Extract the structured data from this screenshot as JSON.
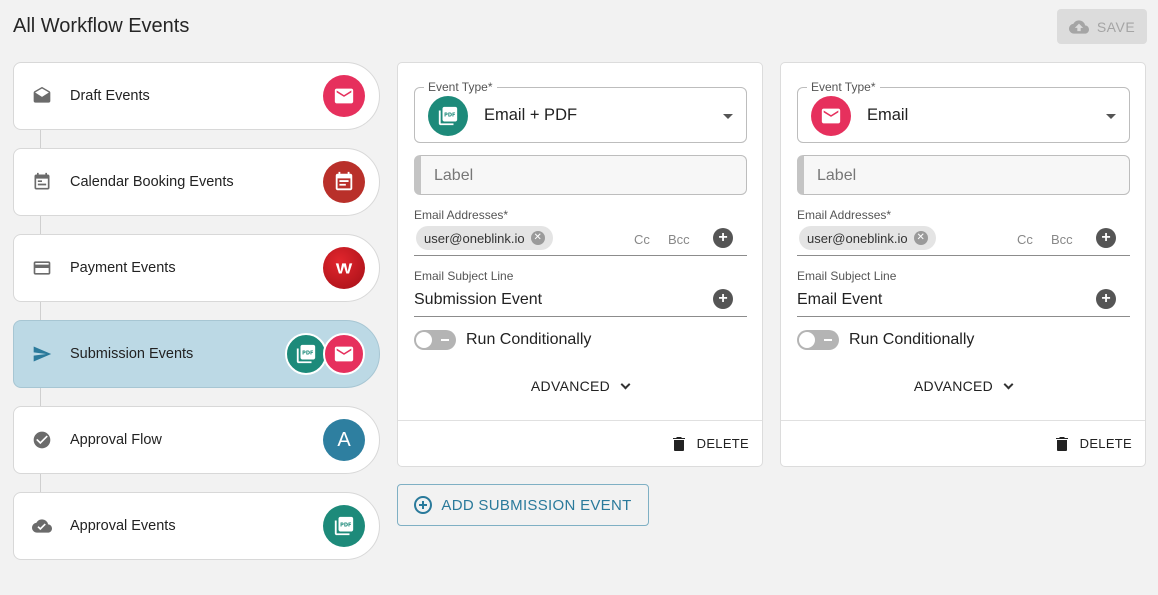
{
  "header": {
    "title": "All Workflow Events",
    "save_label": "SAVE"
  },
  "sidebar": {
    "items": [
      {
        "label": "Draft Events",
        "icon": "draft-envelope-icon",
        "badges": [
          "email"
        ]
      },
      {
        "label": "Calendar Booking Events",
        "icon": "calendar-icon",
        "badges": [
          "calendar"
        ]
      },
      {
        "label": "Payment Events",
        "icon": "credit-card-icon",
        "badges": [
          "westpac"
        ]
      },
      {
        "label": "Submission Events",
        "icon": "send-icon",
        "badges": [
          "pdf",
          "email"
        ],
        "active": true
      },
      {
        "label": "Approval Flow",
        "icon": "check-circle-icon",
        "badges": [
          "approval"
        ],
        "badge_text": "A"
      },
      {
        "label": "Approval Events",
        "icon": "cloud-check-icon",
        "badges": [
          "pdf"
        ]
      }
    ]
  },
  "colors": {
    "email_badge": "#e6305d",
    "calendar_badge": "#b9302a",
    "westpac_badge": "#c4151c",
    "pdf_badge": "#1d8a7a",
    "approval_badge": "#2e7fa0",
    "active_bg": "#bcd9e5",
    "accent": "#2a7a9b"
  },
  "cards": [
    {
      "event_type_legend": "Event Type*",
      "event_type_value": "Email + PDF",
      "event_type_icon": "pdf-icon",
      "label_placeholder": "Label",
      "email_addresses_label": "Email Addresses*",
      "email_chip": "user@oneblink.io",
      "cc": "Cc",
      "bcc": "Bcc",
      "subject_label": "Email Subject Line",
      "subject_value": "Submission Event",
      "run_conditionally": "Run Conditionally",
      "advanced": "ADVANCED",
      "delete": "DELETE"
    },
    {
      "event_type_legend": "Event Type*",
      "event_type_value": "Email",
      "event_type_icon": "email-icon",
      "label_placeholder": "Label",
      "email_addresses_label": "Email Addresses*",
      "email_chip": "user@oneblink.io",
      "cc": "Cc",
      "bcc": "Bcc",
      "subject_label": "Email Subject Line",
      "subject_value": "Email Event",
      "run_conditionally": "Run Conditionally",
      "advanced": "ADVANCED",
      "delete": "DELETE"
    }
  ],
  "add_button": {
    "label": "ADD SUBMISSION EVENT"
  }
}
